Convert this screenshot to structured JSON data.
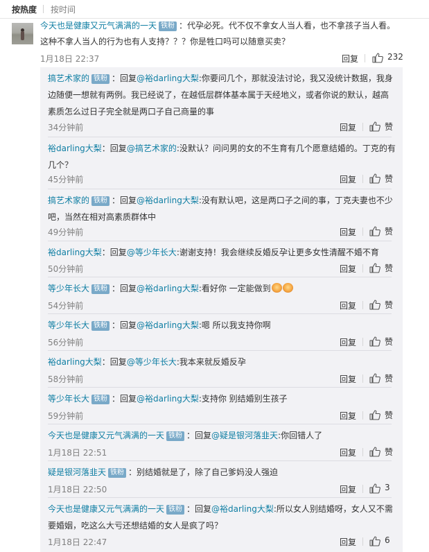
{
  "sort": {
    "hot": "按热度",
    "time": "按时间"
  },
  "main_comment": {
    "author": "今天也是健康又元气满满的一天",
    "badge": "铁粉",
    "text1": "：代孕必死。代不仅不拿女人当人看，也不拿孩子当人看。",
    "text2": "这种不拿人当人的行为也有人支持？？？你是牲口吗可以随意买卖？",
    "time": "1月18日 22:37",
    "reply": "回复",
    "likes": "232"
  },
  "replies": [
    {
      "author": "搞艺术家的",
      "badge": "铁粉",
      "lines": [
        "：回复",
        "@裕darling大梨",
        ":你要问几个，那就没法讨论，我又没统计数据，我身"
      ],
      "cont": [
        "边随便一想就有两例。我已经说了，在越低层群体基本属于天经地义，或者你说的默认，越高",
        "素质怎么过日子完全就是两口子自己商量的事"
      ],
      "time": "34分钟前",
      "reply": "回复",
      "likes": "赞"
    },
    {
      "author": "裕darling大梨",
      "badge": "",
      "lines": [
        "：回复",
        "@搞艺术家的",
        ":没默认？问问男的女的不生育有几个愿意结婚的。丁克的有"
      ],
      "cont": [
        "几个？"
      ],
      "time": "45分钟前",
      "reply": "回复",
      "likes": "赞"
    },
    {
      "author": "搞艺术家的",
      "badge": "铁粉",
      "lines": [
        "：回复",
        "@裕darling大梨",
        ":没有默认吧，这是两口子之间的事，丁克夫妻也不少"
      ],
      "cont": [
        "吧，当然在相对高素质群体中"
      ],
      "time": "49分钟前",
      "reply": "回复",
      "likes": "赞"
    },
    {
      "author": "裕darling大梨",
      "badge": "",
      "lines": [
        "：回复",
        "@等少年长大",
        ":谢谢支持！我会继续反婚反孕让更多女性清醒不婚不育"
      ],
      "cont": [],
      "time": "50分钟前",
      "reply": "回复",
      "likes": "赞"
    },
    {
      "author": "等少年长大",
      "badge": "铁粉",
      "lines": [
        "：回复",
        "@裕darling大梨",
        ":看好你 一定能做到"
      ],
      "cont": [],
      "emoji": "emoji-fist",
      "time": "54分钟前",
      "reply": "回复",
      "likes": "赞"
    },
    {
      "author": "等少年长大",
      "badge": "铁粉",
      "lines": [
        "：回复",
        "@裕darling大梨",
        ":嗯 所以我支持你啊"
      ],
      "cont": [],
      "time": "56分钟前",
      "reply": "回复",
      "likes": "赞"
    },
    {
      "author": "裕darling大梨",
      "badge": "",
      "lines": [
        "：回复",
        "@等少年长大",
        ":我本来就反婚反孕"
      ],
      "cont": [],
      "time": "58分钟前",
      "reply": "回复",
      "likes": "赞"
    },
    {
      "author": "等少年长大",
      "badge": "铁粉",
      "lines": [
        "：回复",
        "@裕darling大梨",
        ":支持你 别结婚别生孩子"
      ],
      "cont": [],
      "time": "59分钟前",
      "reply": "回复",
      "likes": "赞"
    },
    {
      "author": "今天也是健康又元气满满的一天",
      "badge": "铁粉",
      "lines": [
        "：回复",
        "@疑是银河落韭天",
        ":你回错人了"
      ],
      "cont": [],
      "time": "1月18日 22:51",
      "reply": "回复",
      "likes": "赞"
    },
    {
      "author": "疑是银河落韭天",
      "badge": "铁粉",
      "lines": [
        "：别结婚就是了，除了自己爹妈没人强迫",
        "",
        ""
      ],
      "cont": [],
      "time": "1月18日 22:50",
      "reply": "回复",
      "likes": "3"
    },
    {
      "author": "今天也是健康又元气满满的一天",
      "badge": "铁粉",
      "lines": [
        "：回复",
        "@裕darling大梨",
        ":所以女人别结婚呀，女人又不需"
      ],
      "cont": [
        "要婚姻，吃这么大亏还想结婚的女人是疯了吗？"
      ],
      "time": "1月18日 22:47",
      "reply": "回复",
      "likes": "6"
    }
  ],
  "colors": {
    "link": "#0f7ea3",
    "badge": "#79a9c8",
    "muted": "#808080",
    "subbox": "#f2f2f5"
  }
}
